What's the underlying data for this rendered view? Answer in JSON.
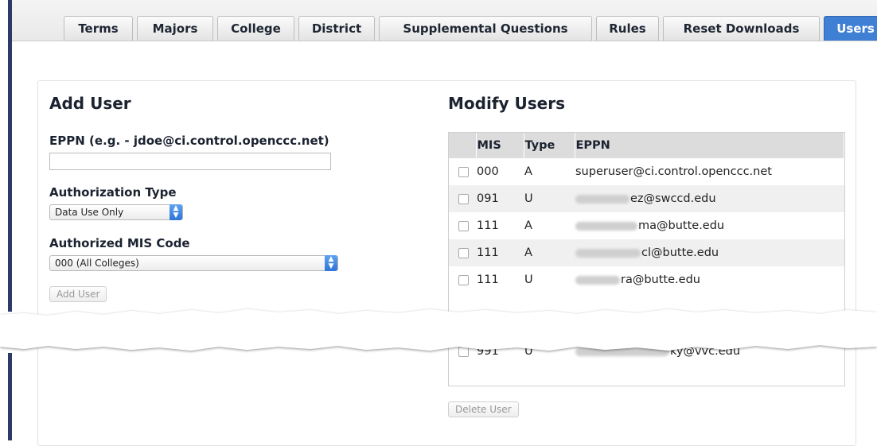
{
  "tabs": [
    {
      "label": "Terms",
      "active": false
    },
    {
      "label": "Majors",
      "active": false
    },
    {
      "label": "College",
      "active": false
    },
    {
      "label": "District",
      "active": false
    },
    {
      "label": "Supplemental Questions",
      "active": false
    },
    {
      "label": "Rules",
      "active": false
    },
    {
      "label": "Reset Downloads",
      "active": false
    },
    {
      "label": "Users",
      "active": true
    }
  ],
  "add_user": {
    "title": "Add User",
    "eppn_label": "EPPN (e.g. - jdoe@ci.control.openccc.net)",
    "eppn_value": "",
    "auth_type_label": "Authorization Type",
    "auth_type_value": "Data Use Only",
    "mis_label": "Authorized MIS Code",
    "mis_value": "000 (All Colleges)",
    "add_button": "Add User"
  },
  "modify_users": {
    "title": "Modify Users",
    "columns": [
      "MIS",
      "Type",
      "EPPN"
    ],
    "rows": [
      {
        "mis": "000",
        "type": "A",
        "eppn": "superuser@ci.control.openccc.net",
        "blurred": false
      },
      {
        "mis": "091",
        "type": "U",
        "eppn": "ez@swccd.edu",
        "blurred": true
      },
      {
        "mis": "111",
        "type": "A",
        "eppn": "ma@butte.edu",
        "blurred": true
      },
      {
        "mis": "111",
        "type": "A",
        "eppn": "cl@butte.edu",
        "blurred": true
      },
      {
        "mis": "111",
        "type": "U",
        "eppn": "ra@butte.edu",
        "blurred": true
      },
      {
        "mis": "991",
        "type": "U",
        "eppn": "ky@vvc.edu",
        "blurred": true
      }
    ],
    "delete_button": "Delete User"
  },
  "colors": {
    "accent": "#3f7fd4",
    "nav_bar": "#2b3a67"
  }
}
